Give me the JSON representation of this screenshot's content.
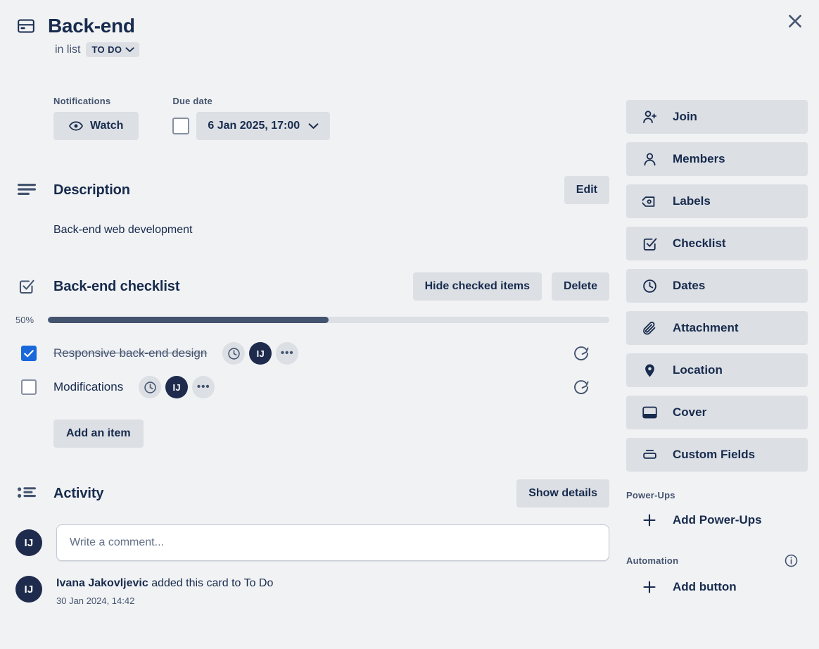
{
  "card": {
    "title": "Back-end",
    "icon": "card-icon",
    "in_list_label": "in list",
    "list_name": "TO DO",
    "close_label": "×"
  },
  "meta": {
    "notifications_label": "Notifications",
    "watch_label": "Watch",
    "due_date_label": "Due date",
    "due_date_value": "6 Jan 2025, 17:00",
    "due_checked": false
  },
  "description": {
    "title": "Description",
    "edit_label": "Edit",
    "body": "Back-end web development"
  },
  "checklist": {
    "title": "Back-end checklist",
    "hide_checked_label": "Hide checked items",
    "delete_label": "Delete",
    "progress_pct_label": "50%",
    "progress_pct": 50,
    "add_item_label": "Add an item",
    "items": [
      {
        "text": "Responsive back-end design",
        "checked": true,
        "avatar": "IJ"
      },
      {
        "text": "Modifications",
        "checked": false,
        "avatar": "IJ"
      }
    ]
  },
  "activity": {
    "title": "Activity",
    "show_details_label": "Show details",
    "comment_avatar": "IJ",
    "comment_placeholder": "Write a comment...",
    "entries": [
      {
        "avatar": "IJ",
        "author": "Ivana Jakovljevic",
        "action": " added this card to To Do",
        "time": "30 Jan 2024, 14:42"
      }
    ]
  },
  "sidebar": {
    "buttons": [
      {
        "label": "Join",
        "icon": "person-add-icon"
      },
      {
        "label": "Members",
        "icon": "person-icon"
      },
      {
        "label": "Labels",
        "icon": "tag-icon"
      },
      {
        "label": "Checklist",
        "icon": "checkbox-icon"
      },
      {
        "label": "Dates",
        "icon": "clock-icon"
      },
      {
        "label": "Attachment",
        "icon": "paperclip-icon"
      },
      {
        "label": "Location",
        "icon": "location-pin-icon"
      },
      {
        "label": "Cover",
        "icon": "cover-icon"
      },
      {
        "label": "Custom Fields",
        "icon": "custom-fields-icon"
      }
    ],
    "power_ups": {
      "group_title": "Power-Ups",
      "add_label": "Add Power-Ups"
    },
    "automation": {
      "group_title": "Automation",
      "add_label": "Add button"
    }
  },
  "colors": {
    "background": "#f1f2f4",
    "button_bg": "#dcdfe4",
    "text": "#172b4d",
    "muted_text": "#44546f",
    "accent_checkbox": "#1868db",
    "avatar_bg": "#1e2b4d",
    "progress_fill": "#44546f"
  }
}
